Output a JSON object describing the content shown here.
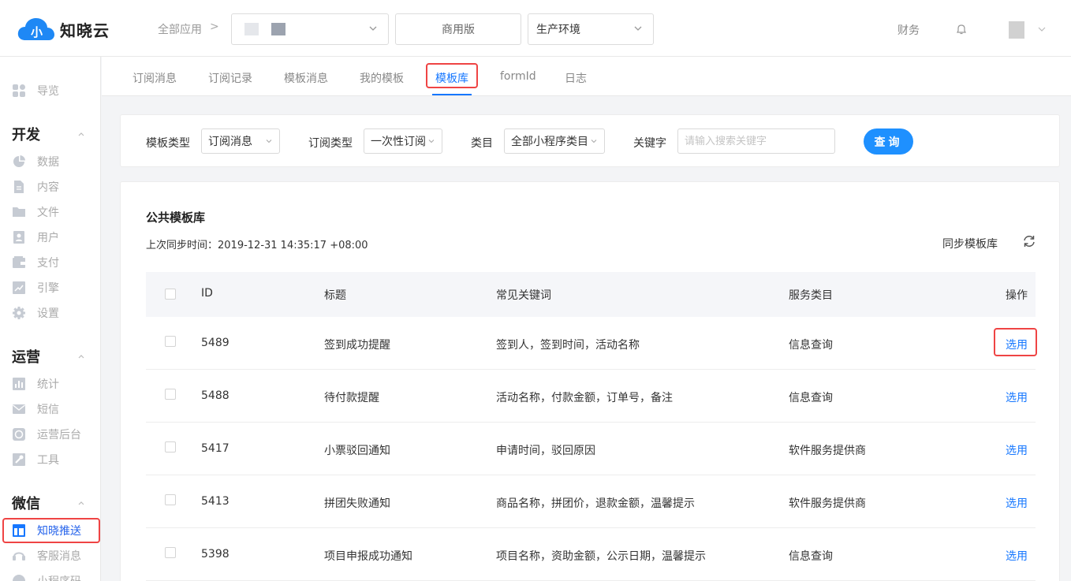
{
  "header": {
    "logo_text": "知晓云",
    "breadcrumb_all_apps": "全部应用",
    "breadcrumb_separator": ">",
    "edition": "商用版",
    "environment": "生产环境",
    "finance": "财务"
  },
  "sidebar": {
    "overview": "导览",
    "groups": [
      {
        "title": "开发",
        "items": [
          "数据",
          "内容",
          "文件",
          "用户",
          "支付",
          "引擎",
          "设置"
        ]
      },
      {
        "title": "运营",
        "items": [
          "统计",
          "短信",
          "运营后台",
          "工具"
        ]
      },
      {
        "title": "微信",
        "items": [
          "知晓推送",
          "客服消息",
          "小程序码"
        ]
      }
    ],
    "active_item": "知晓推送"
  },
  "tabs": [
    {
      "label": "订阅消息",
      "active": false
    },
    {
      "label": "订阅记录",
      "active": false
    },
    {
      "label": "模板消息",
      "active": false
    },
    {
      "label": "我的模板",
      "active": false
    },
    {
      "label": "模板库",
      "active": true
    },
    {
      "label": "formId",
      "active": false
    },
    {
      "label": "日志",
      "active": false
    }
  ],
  "filters": {
    "template_type_label": "模板类型",
    "template_type_value": "订阅消息",
    "subscribe_type_label": "订阅类型",
    "subscribe_type_value": "一次性订阅",
    "category_label": "类目",
    "category_value": "全部小程序类目",
    "keyword_label": "关键字",
    "keyword_placeholder": "请输入搜索关键字",
    "query_button": "查询"
  },
  "library": {
    "title": "公共模板库",
    "last_sync": "上次同步时间：2019-12-31 14:35:17 +08:00",
    "sync_button": "同步模板库",
    "columns": {
      "id": "ID",
      "title": "标题",
      "keywords": "常见关键词",
      "category": "服务类目",
      "action": "操作"
    },
    "rows": [
      {
        "id": "5489",
        "title": "签到成功提醒",
        "keywords": "签到人，签到时间，活动名称",
        "category": "信息查询",
        "action": "选用"
      },
      {
        "id": "5488",
        "title": "待付款提醒",
        "keywords": "活动名称，付款金额，订单号，备注",
        "category": "信息查询",
        "action": "选用"
      },
      {
        "id": "5417",
        "title": "小票驳回通知",
        "keywords": "申请时间，驳回原因",
        "category": "软件服务提供商",
        "action": "选用"
      },
      {
        "id": "5413",
        "title": "拼团失败通知",
        "keywords": "商品名称，拼团价，退款金额，温馨提示",
        "category": "软件服务提供商",
        "action": "选用"
      },
      {
        "id": "5398",
        "title": "项目申报成功通知",
        "keywords": "项目名称，资助金额，公示日期，温馨提示",
        "category": "信息查询",
        "action": "选用"
      }
    ]
  },
  "colors": {
    "accent": "#1677ff",
    "highlight": "#ef4444",
    "logo_blue": "#1e88f5"
  }
}
